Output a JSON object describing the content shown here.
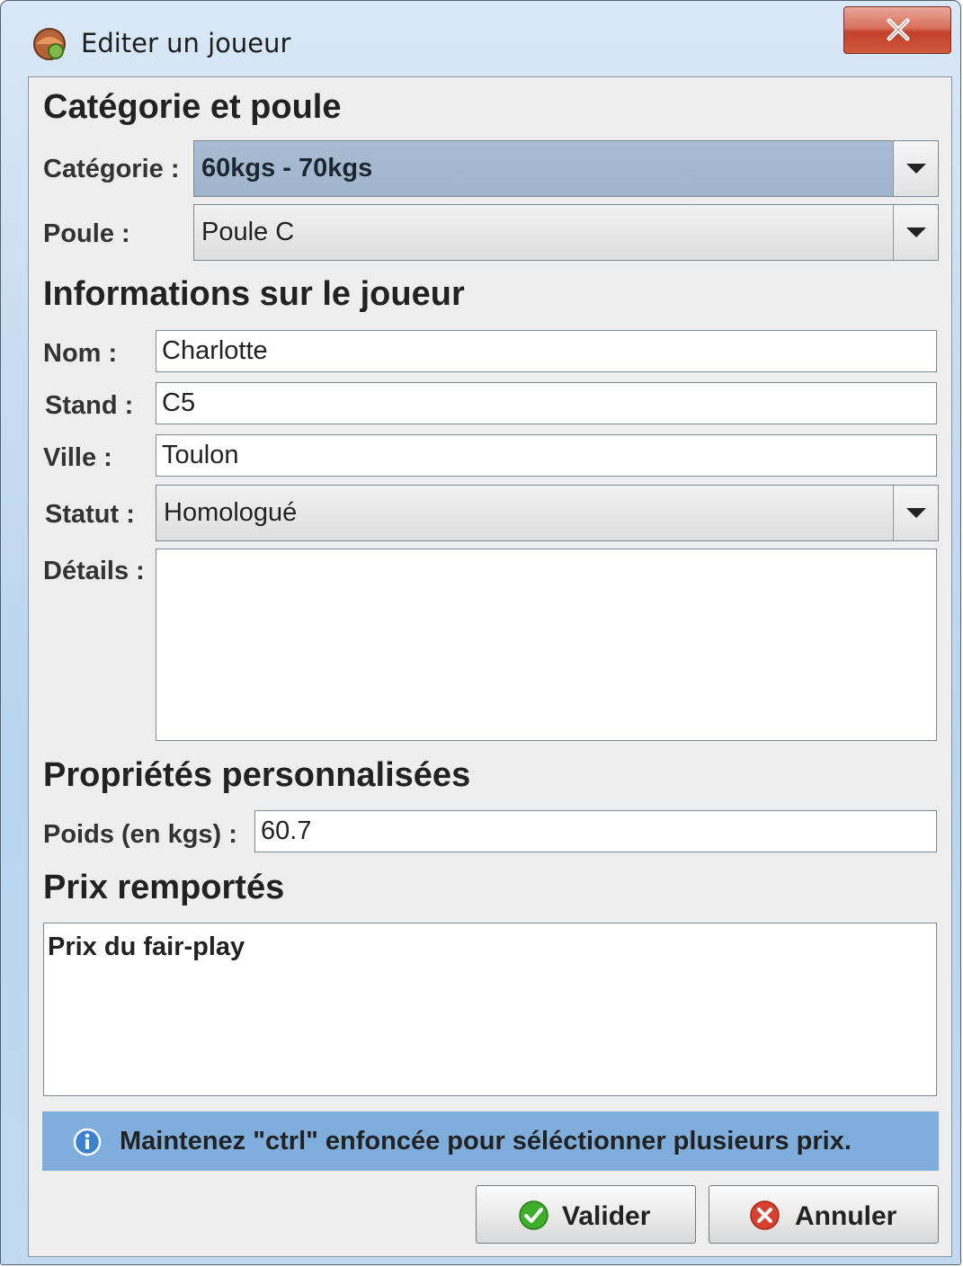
{
  "window": {
    "title": "Editer un joueur"
  },
  "sections": {
    "category": "Catégorie et poule",
    "player_info": "Informations sur le joueur",
    "custom_props": "Propriétés personnalisées",
    "prizes": "Prix remportés"
  },
  "category": {
    "label": "Catégorie :",
    "value": "60kgs - 70kgs"
  },
  "pool": {
    "label": "Poule :",
    "value": "Poule C"
  },
  "player": {
    "name_label": "Nom :",
    "name_value": "Charlotte",
    "stand_label": "Stand :",
    "stand_value": "C5",
    "city_label": "Ville :",
    "city_value": "Toulon",
    "status_label": "Statut :",
    "status_value": "Homologué",
    "details_label": "Détails :",
    "details_value": ""
  },
  "custom": {
    "weight_label": "Poids (en kgs) :",
    "weight_value": "60.7"
  },
  "prizes": {
    "items": [
      "Prix du fair-play"
    ]
  },
  "info": {
    "text": "Maintenez \"ctrl\" enfoncée pour séléctionner plusieurs prix."
  },
  "buttons": {
    "ok": "Valider",
    "cancel": "Annuler"
  },
  "colors": {
    "info_bar": "#80aedc",
    "selected_combo": "#a3b8ce",
    "ok_icon": "#3fae2a",
    "cancel_icon": "#d8402f"
  },
  "icons": {
    "app": "app-icon",
    "close": "close-icon",
    "info": "info-icon",
    "ok": "check-icon",
    "cancel": "cancel-icon"
  }
}
